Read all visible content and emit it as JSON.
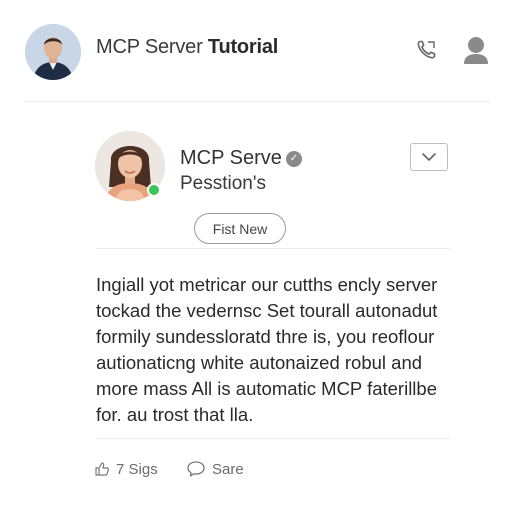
{
  "header": {
    "title_regular": "MCP Server ",
    "title_bold": "Tutorial"
  },
  "card": {
    "title": "MCP Serve",
    "subtitle": "Pesstion's",
    "first_new_label": "Fist New",
    "badge_icon": "verified-badge-icon",
    "online_status": "online"
  },
  "post": {
    "lines": [
      "Ingiall yot metricar our cutths encly server",
      "tockad the vedernsc Set tourall autonadut",
      "formily sundessloratd thre is, you reoflour",
      "autionaticng white autonaized robul and",
      "more mass All is automatic MCP faterillbe",
      "for. au trost that lla."
    ]
  },
  "actions": {
    "likes_label": "7 Sigs",
    "save_label": "Sare"
  },
  "icons": {
    "phone": "phone-icon",
    "user": "user-icon",
    "dropdown": "chevron-down-icon",
    "like": "thumbs-up-icon",
    "comment": "comment-icon"
  },
  "colors": {
    "online": "#3cc45c",
    "divider": "#ececec"
  }
}
